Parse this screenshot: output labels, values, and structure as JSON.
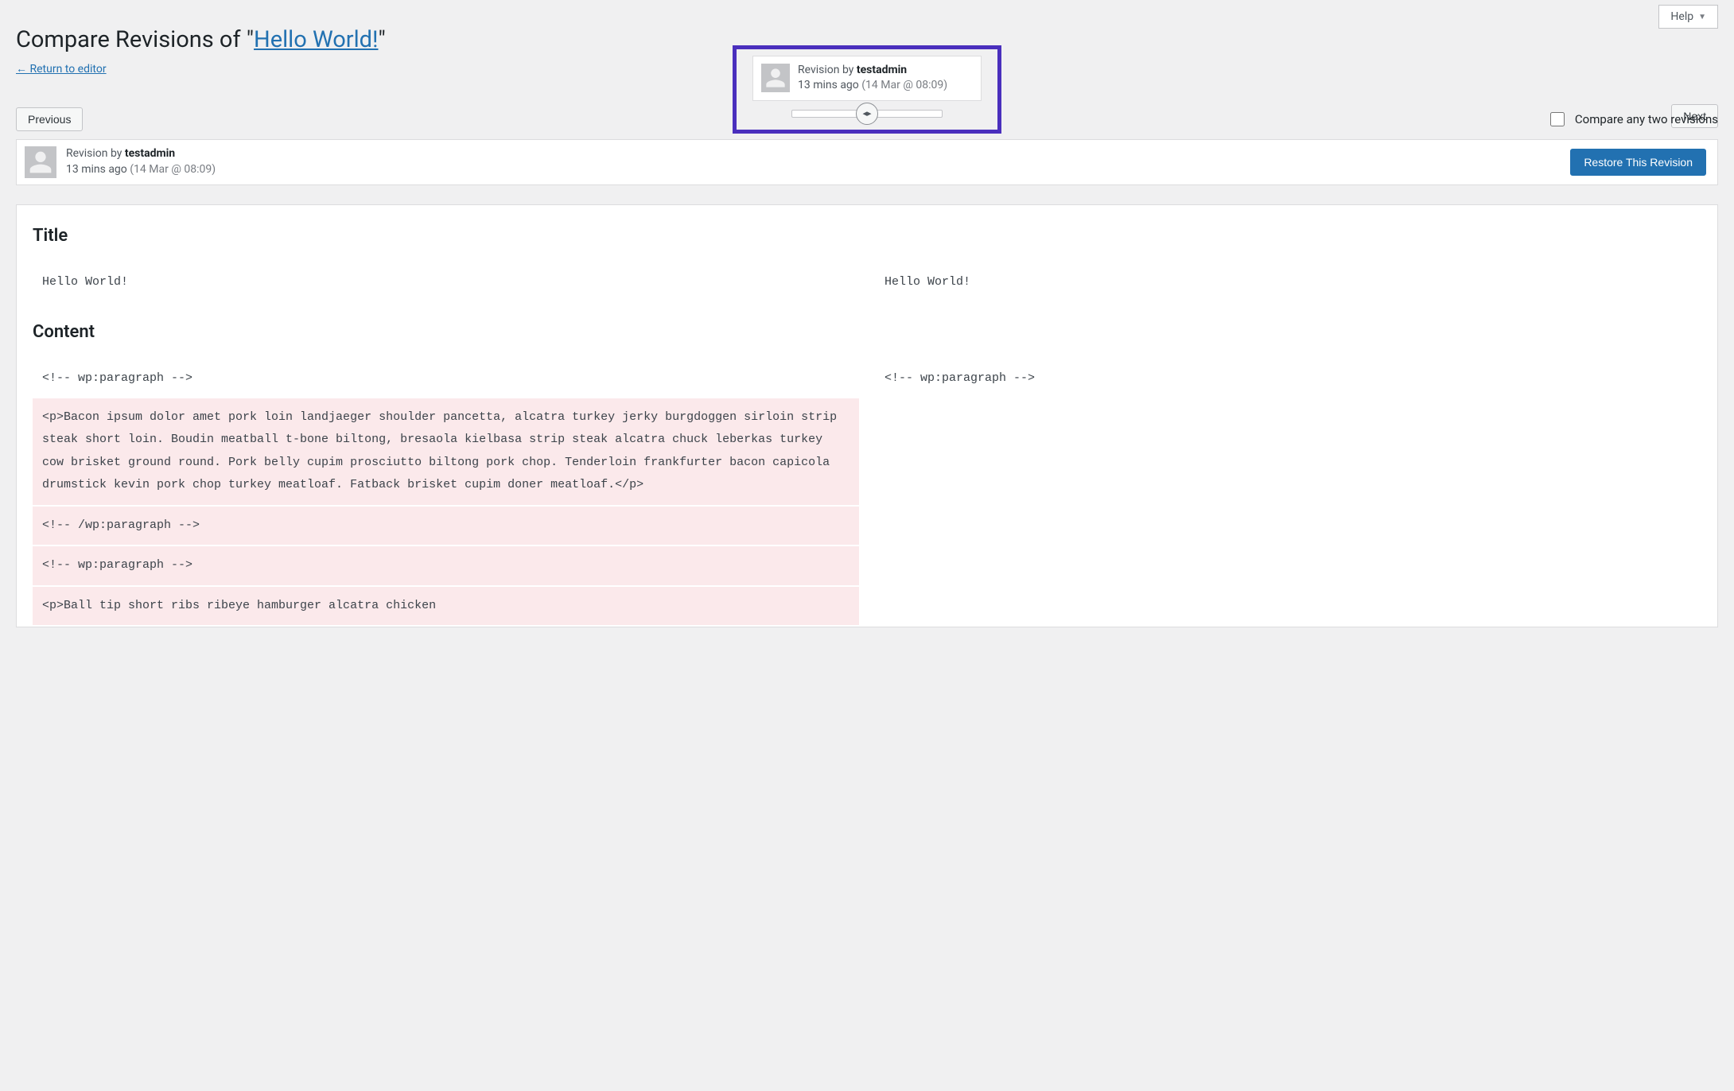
{
  "header": {
    "help_label": "Help",
    "title_prefix": "Compare Revisions of \"",
    "post_title": "Hello World!",
    "title_suffix": "\"",
    "return_link": "← Return to editor"
  },
  "slider": {
    "revision_by_prefix": "Revision by ",
    "author": "testadmin",
    "time_ago": "13 mins ago",
    "timestamp": "(14 Mar @ 08:09)"
  },
  "controls": {
    "previous": "Previous",
    "next": "Next",
    "compare_label": "Compare any two revisions",
    "restore": "Restore This Revision"
  },
  "revision_bar": {
    "revision_by_prefix": "Revision by ",
    "author": "testadmin",
    "time_ago": "13 mins ago",
    "timestamp": "(14 Mar @ 08:09)"
  },
  "diff": {
    "title_heading": "Title",
    "content_heading": "Content",
    "title_left": "Hello World!",
    "title_right": "Hello World!",
    "content_left": [
      {
        "text": "<!-- wp:paragraph -->",
        "removed": false
      },
      {
        "text": "<p>Bacon ipsum dolor amet pork loin landjaeger shoulder pancetta, alcatra turkey jerky burgdoggen sirloin strip steak short loin. Boudin meatball t-bone biltong, bresaola kielbasa strip steak alcatra chuck leberkas turkey cow brisket ground round. Pork belly cupim prosciutto biltong pork chop. Tenderloin frankfurter bacon capicola drumstick kevin pork chop turkey meatloaf. Fatback brisket cupim doner meatloaf.</p>",
        "removed": true
      },
      {
        "text": "<!-- /wp:paragraph -->",
        "removed": true
      },
      {
        "text": "<!-- wp:paragraph -->",
        "removed": true
      },
      {
        "text": "<p>Ball tip short ribs ribeye hamburger alcatra chicken",
        "removed": true
      }
    ],
    "content_right": [
      {
        "text": "<!-- wp:paragraph -->",
        "removed": false
      }
    ]
  }
}
